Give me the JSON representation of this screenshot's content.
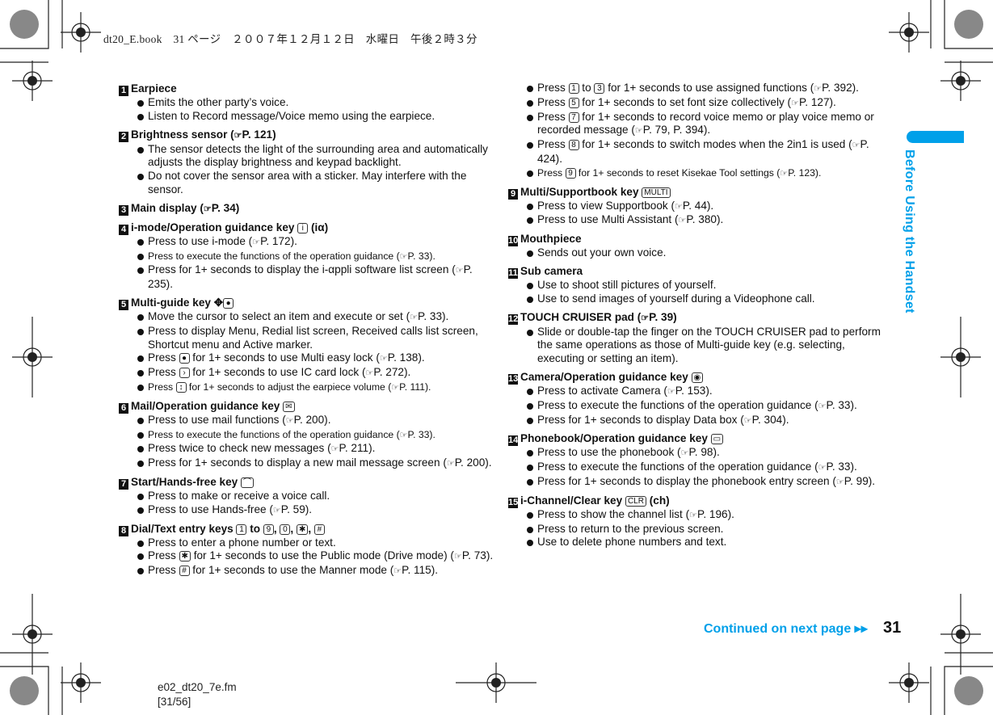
{
  "header": {
    "book_line": "dt20_E.book　31 ページ　２００７年１２月１２日　水曜日　午後２時３分"
  },
  "side_tab": {
    "label": "Before Using the Handset",
    "color": "#00a0e9"
  },
  "footer": {
    "continued": "Continued on next page",
    "page_number": "31",
    "file_name": "e02_dt20_7e.fm",
    "file_pages": "[31/56]"
  },
  "left_column": [
    {
      "num": "1",
      "title": "Earpiece",
      "bullets": [
        "Emits the other party’s voice.",
        "Listen to Record message/Voice memo using the earpiece."
      ]
    },
    {
      "num": "2",
      "title": "Brightness sensor (☞P. 121)",
      "bullets": [
        "The sensor detects the light of the surrounding area and automatically adjusts the display brightness and keypad backlight.",
        "Do not cover the sensor area with a sticker. May interfere with the sensor."
      ]
    },
    {
      "num": "3",
      "title": "Main display (☞P. 34)",
      "bullets": []
    },
    {
      "num": "4",
      "title": "i-mode/Operation guidance key [[i]] (iα)",
      "bullets": [
        "Press to use i-mode (☞P. 172).",
        "~Press to execute the functions of the operation guidance (☞P. 33).",
        "Press for 1+ seconds to display the i-αppli software list screen (☞P. 235)."
      ]
    },
    {
      "num": "5",
      "title": "Multi-guide key ✥[[●]]",
      "bullets": [
        "Move the cursor to select an item and execute or set (☞P. 33).",
        "Press to display Menu, Redial list screen, Received calls list screen, Shortcut menu and Active marker.",
        "Press [[●]] for 1+ seconds to use Multi easy lock (☞P. 138).",
        "Press [[›]] for 1+ seconds to use IC card lock (☞P. 272).",
        "~Press [[↕]] for 1+ seconds to adjust the earpiece volume (☞P. 111)."
      ]
    },
    {
      "num": "6",
      "title": "Mail/Operation guidance key [[✉]]",
      "bullets": [
        "Press to use mail functions (☞P. 200).",
        "~Press to execute the functions of the operation guidance (☞P. 33).",
        "Press twice to check new messages (☞P. 211).",
        "Press for 1+ seconds to display a new mail message screen (☞P. 200)."
      ]
    },
    {
      "num": "7",
      "title": "Start/Hands-free key [[⌒]]",
      "bullets": [
        "Press to make or receive a voice call.",
        "Press to use Hands-free (☞P. 59)."
      ]
    },
    {
      "num": "8",
      "title": "Dial/Text entry keys [[1]] to [[9]], [[0]], [[✱]], [[#]]",
      "bullets": [
        "Press to enter a phone number or text.",
        "Press [[✱]] for 1+ seconds to use the Public mode (Drive mode) (☞P. 73).",
        "Press [[#]] for 1+ seconds to use the Manner mode (☞P. 115)."
      ]
    }
  ],
  "right_column": [
    {
      "num": "",
      "title": "",
      "bullets": [
        "Press [[1]] to [[3]] for 1+ seconds to use assigned functions (☞P. 392).",
        "Press [[5]] for 1+ seconds to set font size collectively (☞P. 127).",
        "Press [[7]] for 1+ seconds to record voice memo or play voice memo or recorded message (☞P. 79, P. 394).",
        "Press [[8]] for 1+ seconds to switch modes when the 2in1 is used (☞P. 424).",
        "~Press [[9]] for 1+ seconds to reset Kisekae Tool settings (☞P. 123)."
      ]
    },
    {
      "num": "9",
      "title": "Multi/Supportbook key [[MULTI]]",
      "bullets": [
        "Press to view Supportbook (☞P. 44).",
        "Press to use Multi Assistant (☞P. 380)."
      ]
    },
    {
      "num": "10",
      "title": "Mouthpiece",
      "bullets": [
        "Sends out your own voice."
      ]
    },
    {
      "num": "11",
      "title": "Sub camera",
      "bullets": [
        "Use to shoot still pictures of yourself.",
        "Use to send images of yourself during a Videophone call."
      ]
    },
    {
      "num": "12",
      "title": "TOUCH CRUISER pad (☞P. 39)",
      "bullets": [
        "Slide or double-tap the finger on the TOUCH CRUISER pad to perform the same operations as those of Multi-guide key (e.g. selecting, executing or setting an item)."
      ]
    },
    {
      "num": "13",
      "title": "Camera/Operation guidance key [[◉]]",
      "bullets": [
        "Press to activate Camera (☞P. 153).",
        "Press to execute the functions of the operation guidance (☞P. 33).",
        "Press for 1+ seconds to display Data box (☞P. 304)."
      ]
    },
    {
      "num": "14",
      "title": "Phonebook/Operation guidance key [[▭]]",
      "bullets": [
        "Press to use the phonebook (☞P. 98).",
        "Press to execute the functions of the operation guidance (☞P. 33).",
        "Press for 1+ seconds to display the phonebook entry screen (☞P. 99)."
      ]
    },
    {
      "num": "15",
      "title": "i-Channel/Clear key [[CLR]] (ch)",
      "bullets": [
        "Press to show the channel list (☞P. 196).",
        "Press to return to the previous screen.",
        "Use to delete phone numbers and text."
      ]
    }
  ]
}
